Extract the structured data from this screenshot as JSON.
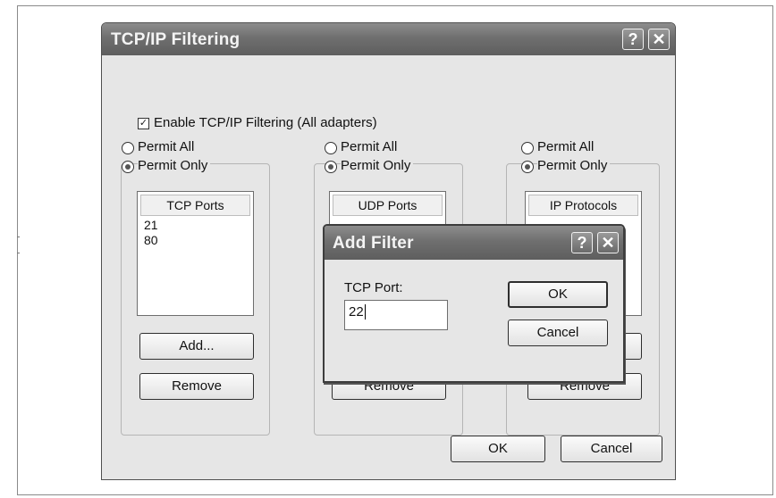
{
  "main_window": {
    "title": "TCP/IP Filtering",
    "help_label": "?",
    "close_label": "✕",
    "enable_label": "Enable TCP/IP Filtering (All adapters)",
    "enable_checked": true
  },
  "columns": [
    {
      "permit_all": "Permit All",
      "permit_only": "Permit Only",
      "header": "TCP Ports",
      "items": [
        "21",
        "80"
      ],
      "add_label": "Add...",
      "remove_label": "Remove"
    },
    {
      "permit_all": "Permit All",
      "permit_only": "Permit Only",
      "header": "UDP Ports",
      "items": [],
      "remove_label": "Remove"
    },
    {
      "permit_all": "Permit All",
      "permit_only": "Permit Only",
      "header": "IP Protocols",
      "items": [],
      "remove_label": "Remove"
    }
  ],
  "footer": {
    "ok_label": "OK",
    "cancel_label": "Cancel"
  },
  "add_filter": {
    "title": "Add Filter",
    "help_label": "?",
    "close_label": "✕",
    "field_label": "TCP Port:",
    "field_value": "22",
    "ok_label": "OK",
    "cancel_label": "Cancel"
  }
}
